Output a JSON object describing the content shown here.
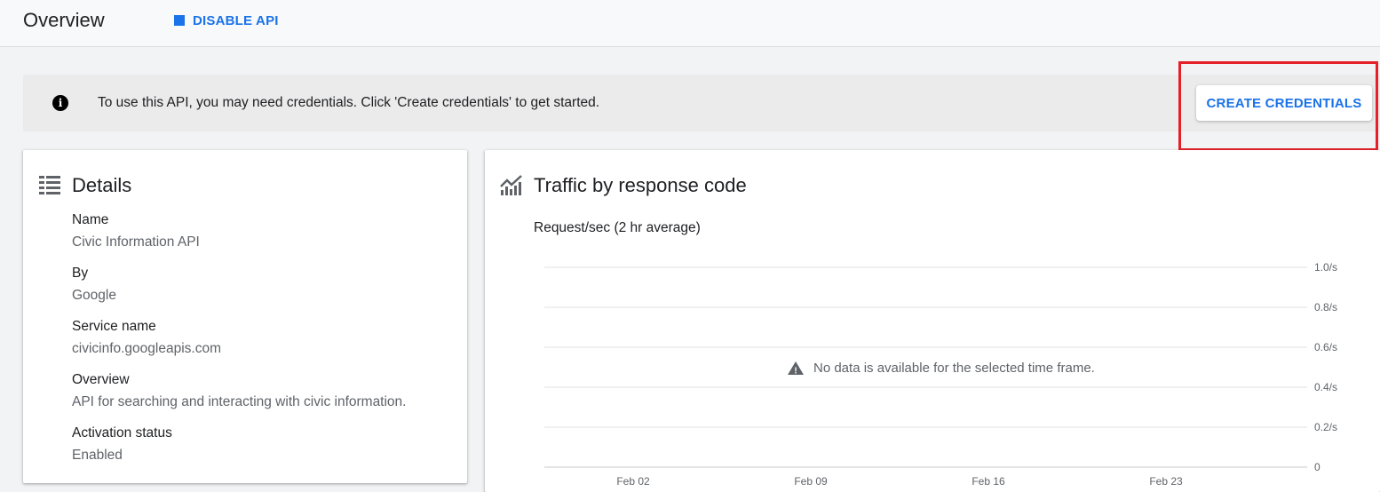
{
  "header": {
    "title": "Overview",
    "disable_label": "DISABLE API"
  },
  "banner": {
    "message": "To use this API, you may need credentials. Click 'Create credentials' to get started.",
    "create_label": "CREATE CREDENTIALS"
  },
  "details": {
    "title": "Details",
    "fields": [
      {
        "label": "Name",
        "value": "Civic Information API"
      },
      {
        "label": "By",
        "value": "Google"
      },
      {
        "label": "Service name",
        "value": "civicinfo.googleapis.com"
      },
      {
        "label": "Overview",
        "value": "API for searching and interacting with civic information."
      },
      {
        "label": "Activation status",
        "value": "Enabled"
      }
    ]
  },
  "traffic": {
    "title": "Traffic by response code",
    "subtitle": "Request/sec (2 hr average)",
    "no_data_message": "No data is available for the selected time frame."
  },
  "chart_data": {
    "type": "line",
    "title": "Traffic by response code",
    "ylabel": "Request/sec (2 hr average)",
    "xlabel": "",
    "x_ticks": [
      "Feb 02",
      "Feb 09",
      "Feb 16",
      "Feb 23"
    ],
    "y_ticks": [
      "0",
      "0.2/s",
      "0.4/s",
      "0.6/s",
      "0.8/s",
      "1.0/s"
    ],
    "ylim": [
      0,
      1.0
    ],
    "grid": true,
    "series": []
  },
  "colors": {
    "accent": "#1a73e8",
    "highlight": "#e52029",
    "banner_bg": "#ebebeb"
  },
  "icons": {
    "disable": "stop-square-icon",
    "info": "info-icon",
    "details": "list-icon",
    "traffic": "trending-chart-icon",
    "warning": "warning-icon"
  }
}
